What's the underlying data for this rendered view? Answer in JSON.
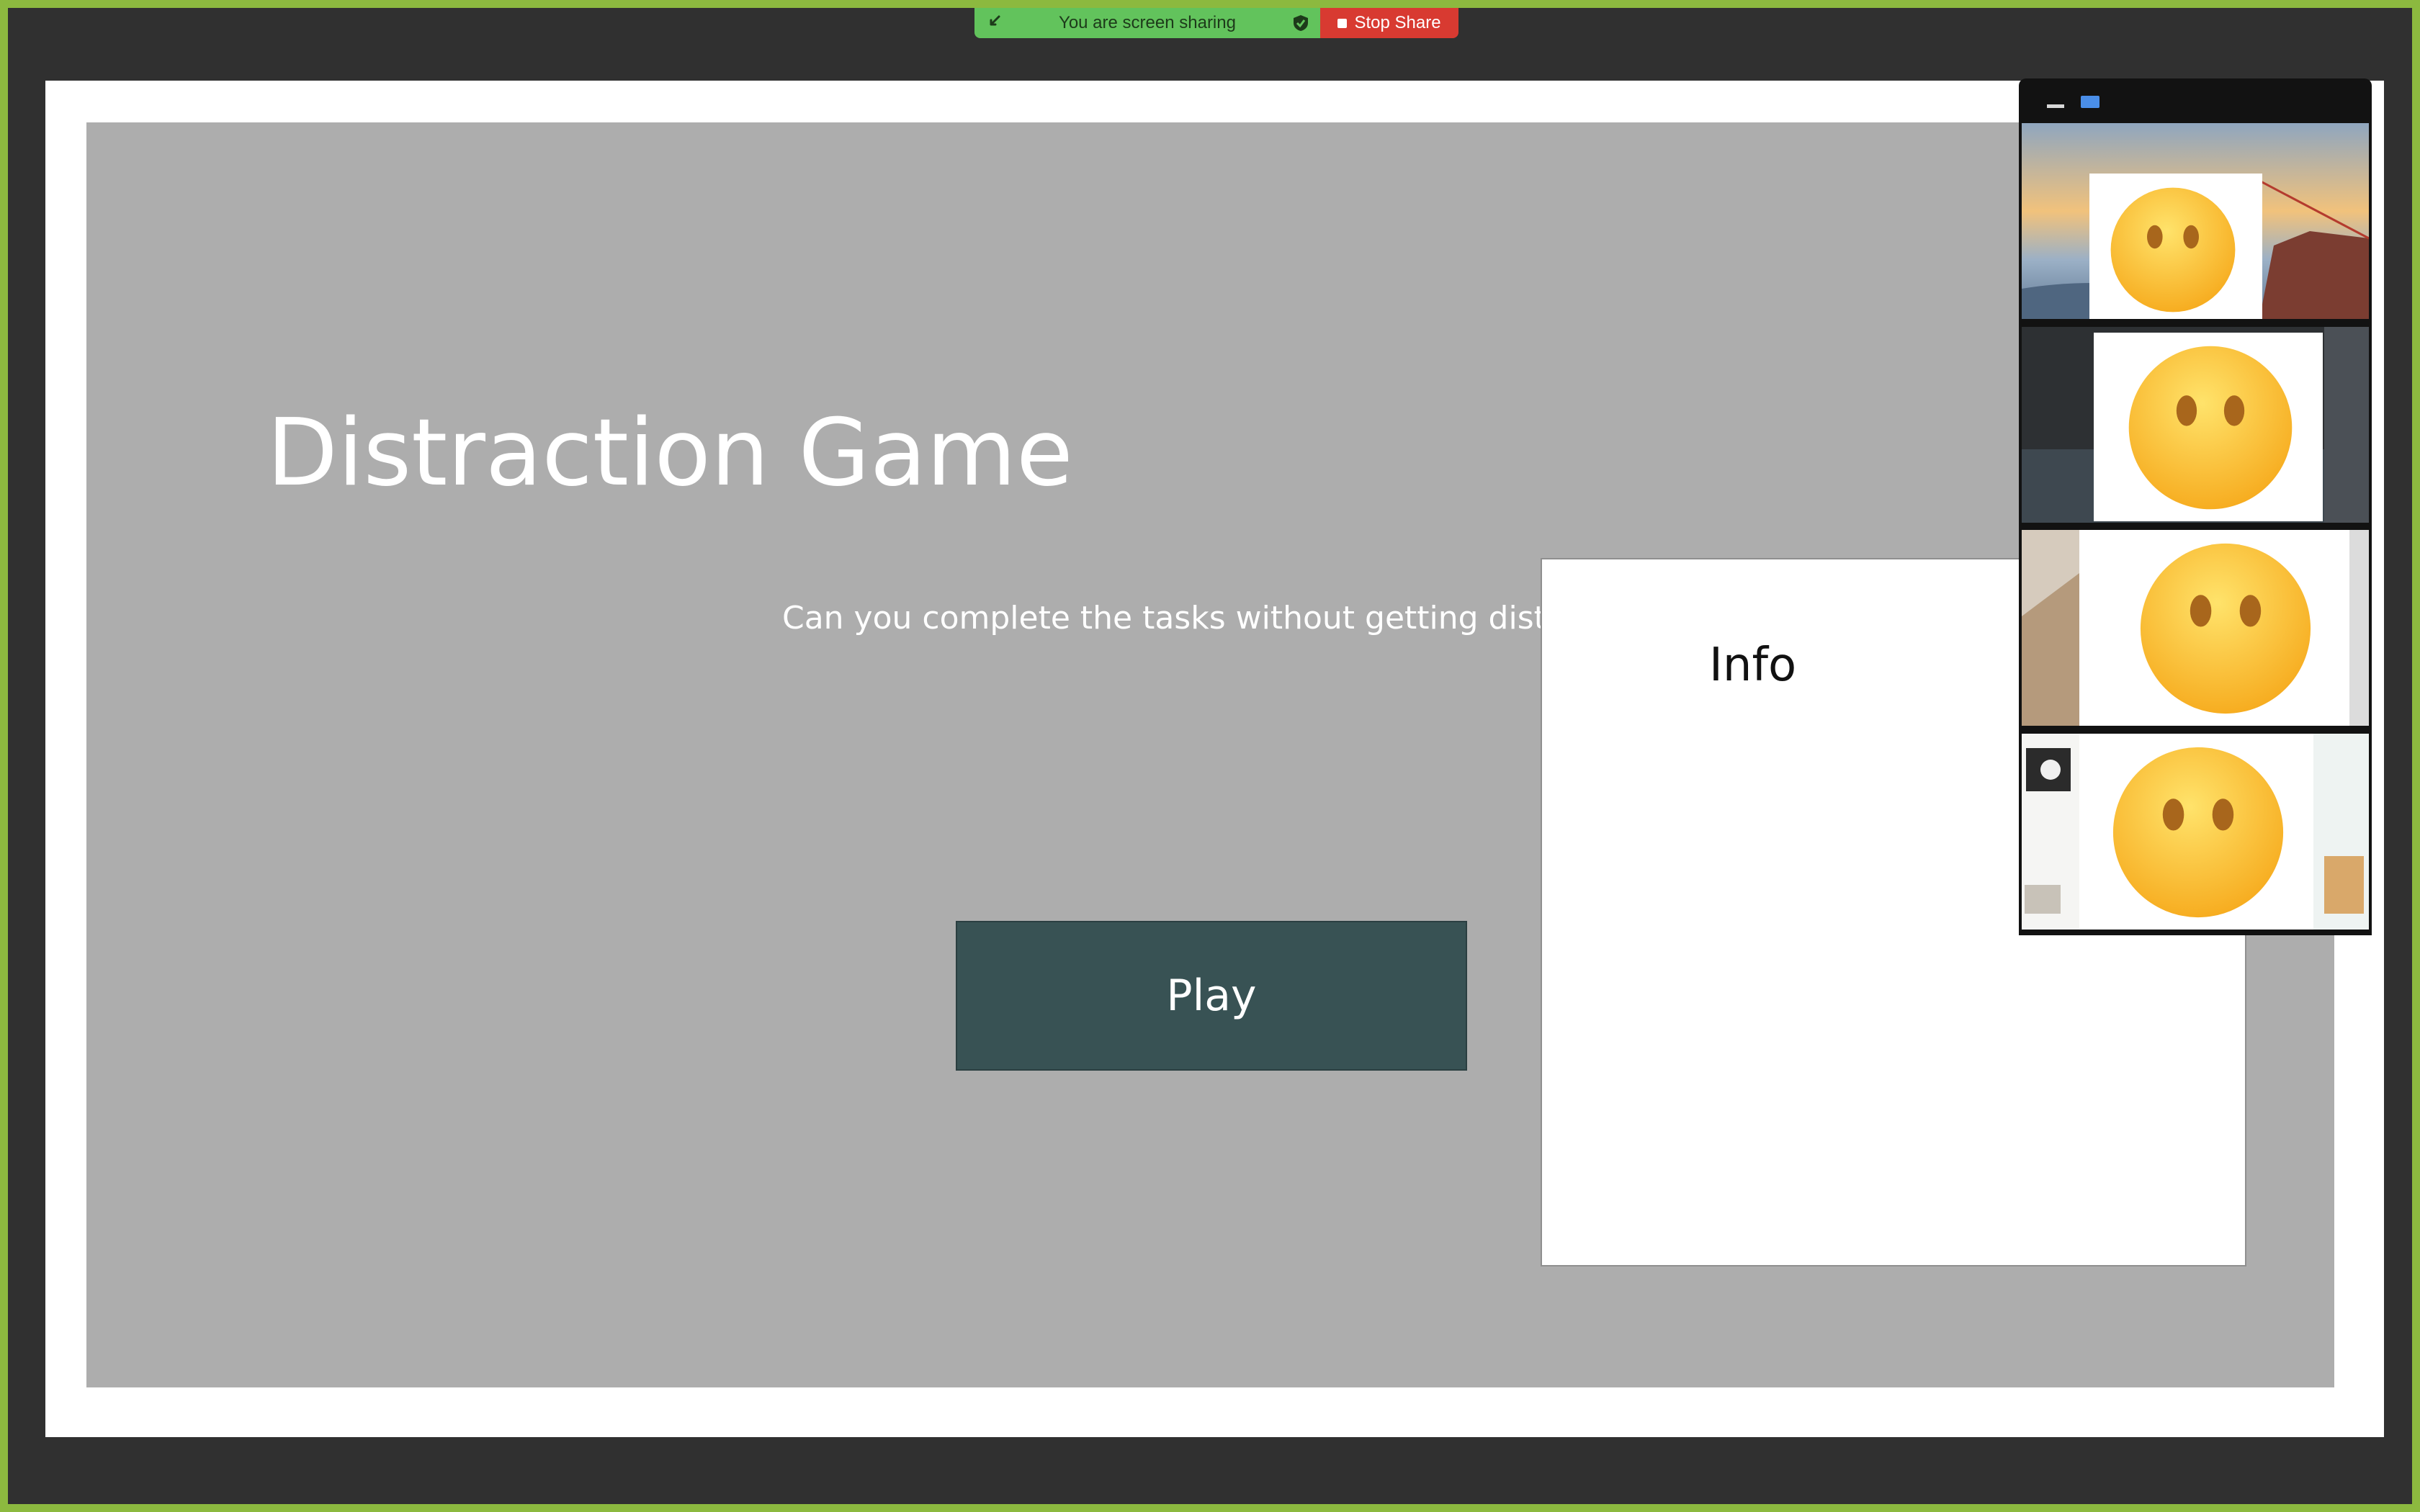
{
  "share_bar": {
    "status_text": "You are screen sharing",
    "stop_label": "Stop Share"
  },
  "slide": {
    "title": "Distraction Game",
    "subtitle": "Can you complete the tasks without getting distr",
    "play_label": "Play"
  },
  "info_panel": {
    "title": "Info"
  },
  "video_gallery": {
    "participants": [
      {
        "avatar": "neutral-face-emoji",
        "background": "golden-gate-bridge-sunset"
      },
      {
        "avatar": "neutral-face-emoji",
        "background": "dark-bedroom"
      },
      {
        "avatar": "neutral-face-emoji",
        "background": "bright-room"
      },
      {
        "avatar": "neutral-face-emoji",
        "background": "office-desk"
      }
    ]
  },
  "colors": {
    "screen_border": "#8cb93f",
    "share_green": "#62c35c",
    "stop_red": "#d83a31",
    "slide_background": "#adadad",
    "play_button": "#385254"
  }
}
